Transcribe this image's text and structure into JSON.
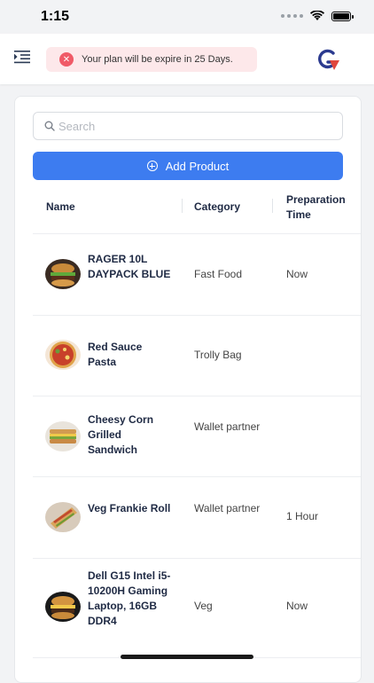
{
  "status_bar": {
    "time": "1:15"
  },
  "header": {
    "plan_notice": "Your plan will be expire in 25 Days.",
    "icons": {
      "menu": "menu-collapse-icon",
      "logo": "brand-logo-g",
      "notice": "close-circle-icon"
    }
  },
  "search": {
    "placeholder": "Search",
    "value": ""
  },
  "add_product": {
    "label": "Add Product"
  },
  "table": {
    "columns": [
      "Name",
      "Category",
      "Preparation\nTime"
    ],
    "rows": [
      {
        "name": "RAGER 10L DAYPACK BLUE",
        "category": "Fast Food",
        "prep": "Now",
        "image": "burger"
      },
      {
        "name": "Red Sauce Pasta",
        "category": "Trolly Bag",
        "prep": "",
        "image": "pizza"
      },
      {
        "name": "Cheesy Corn Grilled Sandwich",
        "category": "Wallet partner",
        "prep": "",
        "image": "sandwich"
      },
      {
        "name": "Veg Frankie Roll",
        "category": "Wallet partner",
        "prep": "1 Hour",
        "image": "wrap"
      },
      {
        "name": "Dell G15 Intel i5-10200H Gaming Laptop, 16GB DDR4",
        "category": "Veg",
        "prep": "Now",
        "image": "burger"
      }
    ]
  },
  "colors": {
    "accent": "#3d7cf0",
    "notice_bg": "#fde8ea",
    "notice_icon": "#f05a67",
    "logo_blue": "#2b3a8f",
    "logo_red": "#e0463d"
  }
}
